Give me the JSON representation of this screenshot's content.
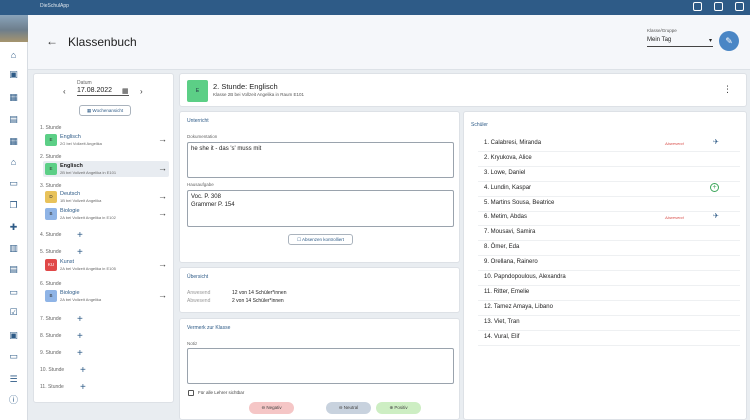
{
  "topbar": {
    "app_name": "DieSchulApp",
    "tagline": "",
    "brand_color": "#2e5b87"
  },
  "header": {
    "title": "Klassenbuch",
    "kg_label": "Klasse/Gruppe",
    "kg_value": "Mein Tag"
  },
  "datepicker": {
    "label": "Datum",
    "value": "17.08.2022",
    "wochen_label": "Wochenansicht"
  },
  "slots": [
    {
      "label": "1. Stunde"
    },
    {
      "label": "2. Stunde"
    },
    {
      "label": "3. Stunde"
    },
    {
      "label": "4. Stunde"
    },
    {
      "label": "5. Stunde"
    },
    {
      "label": "6. Stunde"
    },
    {
      "label": "7. Stunde"
    },
    {
      "label": "8. Stunde"
    },
    {
      "label": "9. Stunde"
    },
    {
      "label": "10. Stunde"
    },
    {
      "label": "11. Stunde"
    }
  ],
  "lessons": [
    {
      "badge": "E",
      "name": "Englisch",
      "sub": "2G bei Vollzeit Angelika",
      "color": "#5ccf86"
    },
    {
      "badge": "E",
      "name": "Englisch",
      "sub": "2B bei Vollzeit Angelika in E101",
      "color": "#5ccf86"
    },
    {
      "badge": "D",
      "name": "Deutsch",
      "sub": "1B bei Vollzeit Angelika",
      "color": "#e8c25a"
    },
    {
      "badge": "B",
      "name": "Biologie",
      "sub": "2A bei Vollzeit Angelika in E102",
      "color": "#8fb4e6"
    },
    {
      "badge": "KU",
      "name": "Kunst",
      "sub": "2A bei Vollzeit Angelika in E105",
      "color": "#e04848"
    },
    {
      "badge": "B",
      "name": "Biologie",
      "sub": "2A bei Vollzeit Angelika",
      "color": "#8fb4e6"
    }
  ],
  "lesson_head": {
    "badge": "E",
    "title": "2. Stunde: Englisch",
    "sub": "Klasse 2B bei Vollzeit Angelika in Raum E101"
  },
  "unterricht": {
    "title": "Unterricht",
    "doc_label": "Dokumentation",
    "doc_value": "he she it - das 's' muss mit",
    "hw_label": "Hausaufgabe",
    "hw_value": "Voc. P. 308\nGrammer P. 154",
    "abs_btn": "Absenzen kontrolliert"
  },
  "uebersicht": {
    "title": "Übersicht",
    "present_key": "Anwesend",
    "present_val": "12 von 14 Schüler*innen",
    "absent_key": "Abwesend",
    "absent_val": "2 von 14 Schüler*innen"
  },
  "vermerk": {
    "title": "Vermerk zur Klasse",
    "notiz_label": "Notiz",
    "visible_label": "Für alle Lehrer sichtbar",
    "neg": "Negativ",
    "neu": "Neutral",
    "pos": "Positiv"
  },
  "schueler": {
    "title": "Schüler",
    "absent_label": "Abwesend",
    "list": [
      "1. Calabresi, Miranda",
      "2. Kryukova, Alice",
      "3. Lowe, Daniel",
      "4. Lundin, Kaspar",
      "5. Martins Sousa, Beatrice",
      "6. Metim, Abdas",
      "7. Mousavi, Samira",
      "8. Ömer, Eda",
      "9. Orellana, Rainero",
      "10. Papndopoulous, Alexandra",
      "11. Ritter, Emelie",
      "12. Tamez Amaya, Libano",
      "13. Viet, Tran",
      "14. Vural, Elif"
    ]
  }
}
